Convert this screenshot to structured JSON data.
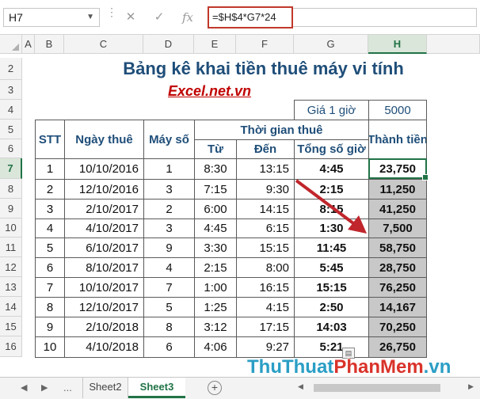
{
  "formula_bar": {
    "name_box": "H7",
    "cancel_icon": "✕",
    "enter_icon": "✓",
    "fx_label": "fx",
    "formula": "=$H$4*G7*24"
  },
  "columns": [
    "A",
    "B",
    "C",
    "D",
    "E",
    "F",
    "G",
    "H"
  ],
  "selected_column": "H",
  "rows": [
    "2",
    "3",
    "4",
    "5",
    "6",
    "7",
    "8",
    "9",
    "10",
    "11",
    "12",
    "13",
    "14",
    "15",
    "16"
  ],
  "selected_row": "7",
  "sheet": {
    "title": "Bảng kê khai tiền thuê máy vi tính",
    "subtitle": "Excel.net.vn",
    "rate_label": "Giá 1 giờ",
    "rate_value": "5000",
    "headers": {
      "stt": "STT",
      "date": "Ngày thuê",
      "machine": "Máy số",
      "rental_time": "Thời gian thuê",
      "from": "Từ",
      "to": "Đến",
      "total_hours": "Tổng số giờ",
      "amount": "Thành tiền"
    },
    "data_rows": [
      {
        "stt": "1",
        "date": "10/10/2016",
        "machine": "1",
        "from": "8:30",
        "to": "13:15",
        "total": "4:45",
        "amount": "23,750"
      },
      {
        "stt": "2",
        "date": "12/10/2016",
        "machine": "3",
        "from": "7:15",
        "to": "9:30",
        "total": "2:15",
        "amount": "11,250"
      },
      {
        "stt": "3",
        "date": "2/10/2017",
        "machine": "2",
        "from": "6:00",
        "to": "14:15",
        "total": "8:15",
        "amount": "41,250"
      },
      {
        "stt": "4",
        "date": "4/10/2017",
        "machine": "3",
        "from": "4:45",
        "to": "6:15",
        "total": "1:30",
        "amount": "7,500"
      },
      {
        "stt": "5",
        "date": "6/10/2017",
        "machine": "9",
        "from": "3:30",
        "to": "15:15",
        "total": "11:45",
        "amount": "58,750"
      },
      {
        "stt": "6",
        "date": "8/10/2017",
        "machine": "4",
        "from": "2:15",
        "to": "8:00",
        "total": "5:45",
        "amount": "28,750"
      },
      {
        "stt": "7",
        "date": "10/10/2017",
        "machine": "7",
        "from": "1:00",
        "to": "16:15",
        "total": "15:15",
        "amount": "76,250"
      },
      {
        "stt": "8",
        "date": "12/10/2017",
        "machine": "5",
        "from": "1:25",
        "to": "4:15",
        "total": "2:50",
        "amount": "14,167"
      },
      {
        "stt": "9",
        "date": "2/10/2018",
        "machine": "8",
        "from": "3:12",
        "to": "17:15",
        "total": "14:03",
        "amount": "70,250"
      },
      {
        "stt": "10",
        "date": "4/10/2018",
        "machine": "6",
        "from": "4:06",
        "to": "9:27",
        "total": "5:21",
        "amount": "26,750"
      }
    ]
  },
  "tabs": {
    "nav_prev": "◀",
    "nav_next": "▶",
    "more": "...",
    "sheets": [
      "Sheet2",
      "Sheet3"
    ],
    "active_sheet": "Sheet3",
    "add_icon": "+"
  },
  "watermark": {
    "part1": "ThuThuat",
    "part2": "PhanMem",
    "part3": ".vn"
  },
  "colors": {
    "header_text": "#1f4e79",
    "subtitle": "#c00000",
    "excel_green": "#217346",
    "shaded_cell": "#c8c8c8",
    "arrow": "#c0262c"
  }
}
